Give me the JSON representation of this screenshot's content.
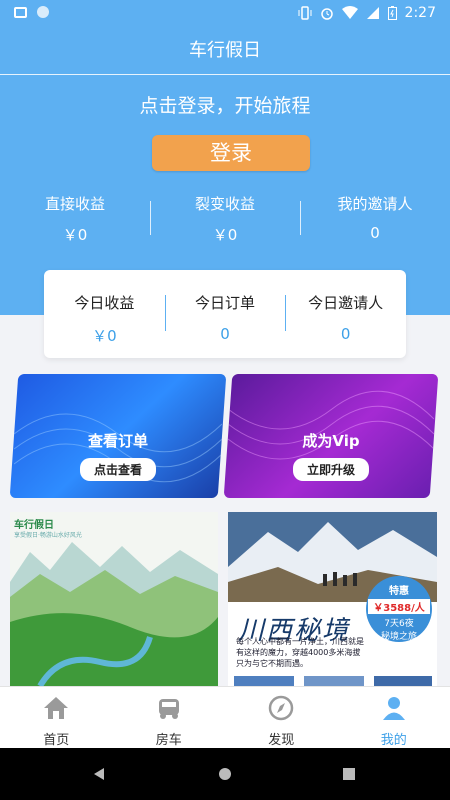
{
  "status_bar": {
    "time": "2:27"
  },
  "app": {
    "title": "车行假日"
  },
  "hero": {
    "prompt": "点击登录，开始旅程",
    "login_label": "登录",
    "stats": [
      {
        "label": "直接收益",
        "value": "￥0"
      },
      {
        "label": "裂变收益",
        "value": "￥0"
      },
      {
        "label": "我的邀请人",
        "value": "0"
      }
    ]
  },
  "today_card": {
    "cells": [
      {
        "label": "今日收益",
        "value": "￥0"
      },
      {
        "label": "今日订单",
        "value": "0"
      },
      {
        "label": "今日邀请人",
        "value": "0"
      }
    ]
  },
  "promos": [
    {
      "title": "查看订单",
      "button": "点击查看"
    },
    {
      "title": "成为Vip",
      "button": "立即升级"
    }
  ],
  "feed": {
    "left": {
      "brand": "车行假日",
      "brand_sub": "享受假日·畅游山水好风光"
    },
    "right": {
      "title": "川西秘境",
      "badge_top": "特惠",
      "price": "￥3588/人",
      "duration": "7天6夜",
      "subtitle": "秘境之旅",
      "description": "每个人心中都有一片净土，川西就是有这样的魔力，穿越4000多米海拔只为与它不期而遇。"
    }
  },
  "tabbar": {
    "items": [
      {
        "label": "首页",
        "icon": "home-icon"
      },
      {
        "label": "房车",
        "icon": "rv-icon"
      },
      {
        "label": "发现",
        "icon": "compass-icon"
      },
      {
        "label": "我的",
        "icon": "user-icon"
      }
    ],
    "active_color": "#3da0e8"
  },
  "colors": {
    "primary": "#5db0f2",
    "login_button": "#f2a24d"
  }
}
